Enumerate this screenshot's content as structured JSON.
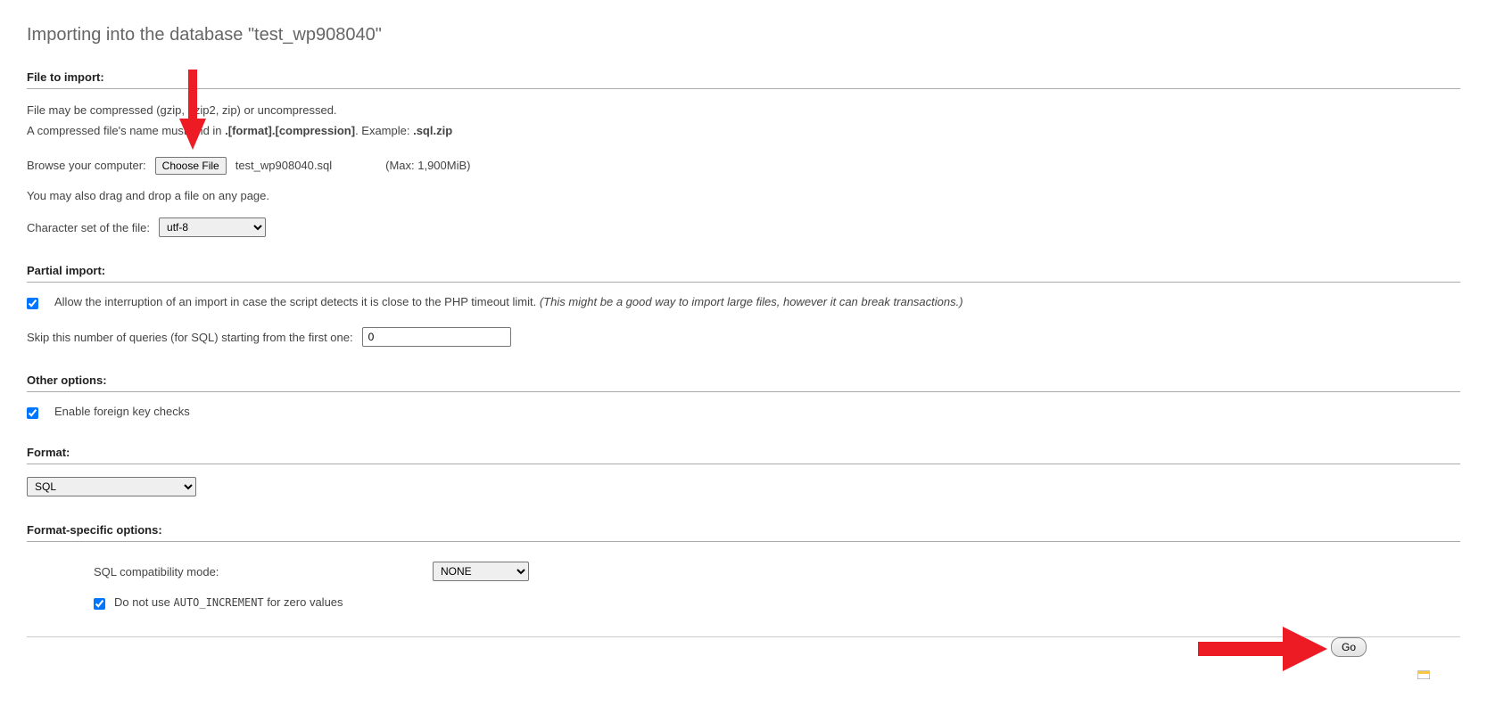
{
  "page": {
    "title_prefix": "Importing into the database \"",
    "title_db": "test_wp908040",
    "title_suffix": "\""
  },
  "file_import": {
    "heading": "File to import:",
    "compress_line": "File may be compressed (gzip, bzip2, zip) or uncompressed.",
    "name_hint_1": "A compressed file's name must end in ",
    "name_hint_bold": ".[format].[compression]",
    "name_hint_2": ". Example: ",
    "name_hint_example": ".sql.zip",
    "browse_label": "Browse your computer:",
    "choose_button": "Choose File",
    "chosen_filename": "test_wp908040.sql",
    "max_size": "(Max: 1,900MiB)",
    "drag_hint": "You may also drag and drop a file on any page.",
    "charset_label": "Character set of the file:",
    "charset_value": "utf-8"
  },
  "partial_import": {
    "heading": "Partial import:",
    "allow_interrupt_1": "Allow the interruption of an import in case the script detects it is close to the PHP timeout limit. ",
    "allow_interrupt_italic": "(This might be a good way to import large files, however it can break transactions.)",
    "skip_label": "Skip this number of queries (for SQL) starting from the first one:",
    "skip_value": "0"
  },
  "other_options": {
    "heading": "Other options:",
    "fk_label": "Enable foreign key checks"
  },
  "format": {
    "heading": "Format:",
    "value": "SQL"
  },
  "format_specific": {
    "heading": "Format-specific options:",
    "compat_label": "SQL compatibility mode:",
    "compat_value": "NONE",
    "auto_inc_label_1": "Do not use ",
    "auto_inc_code": "AUTO_INCREMENT",
    "auto_inc_label_2": " for zero values"
  },
  "go_button": "Go"
}
